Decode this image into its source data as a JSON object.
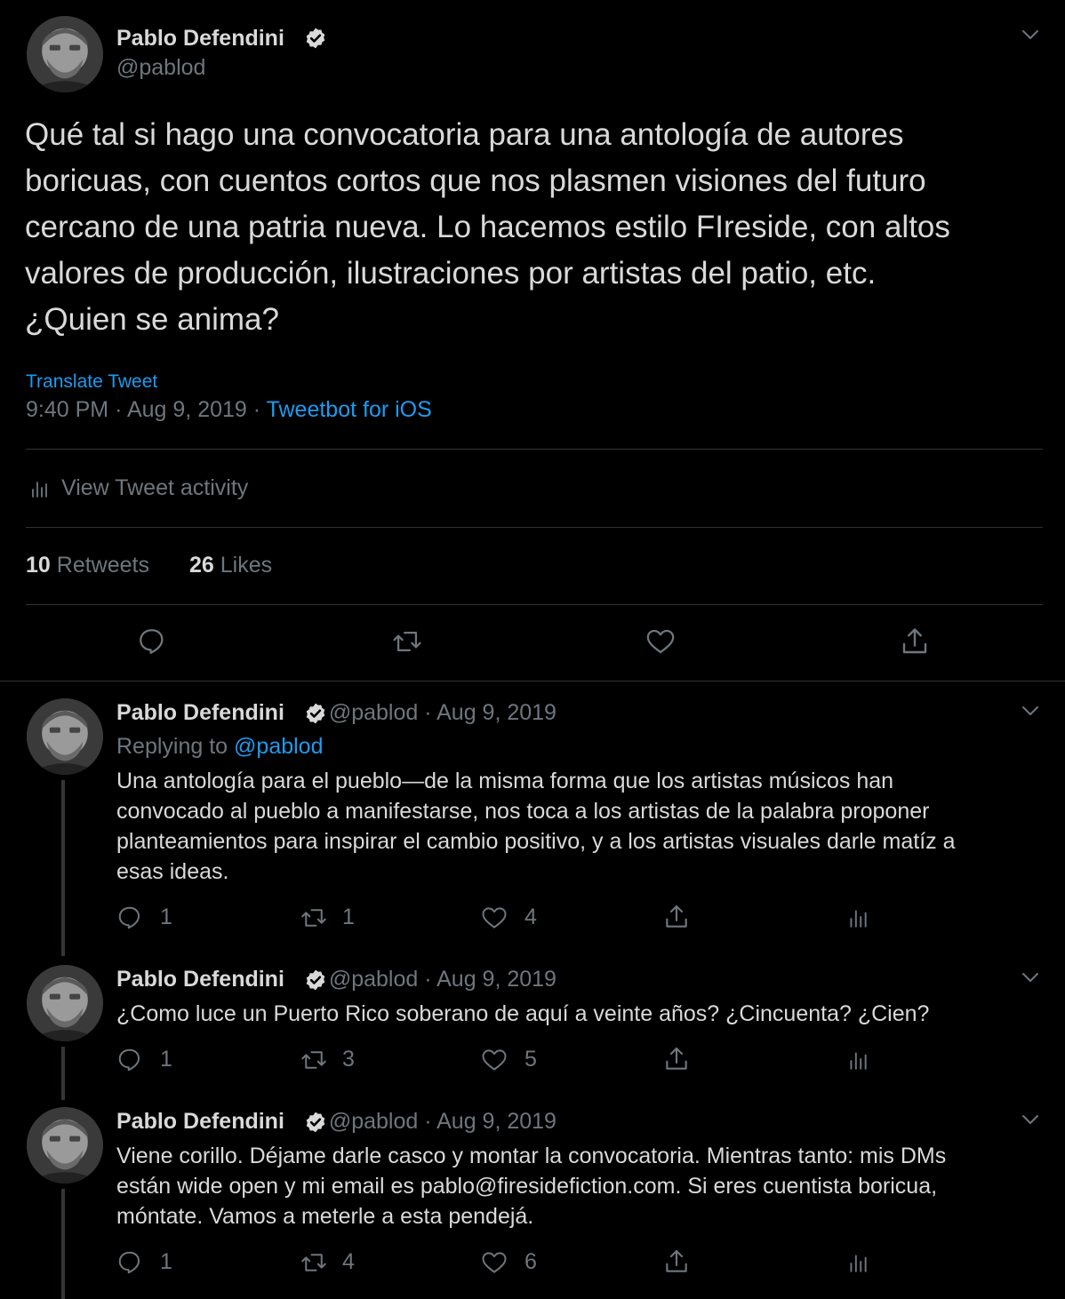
{
  "main_tweet": {
    "author_name": "Pablo Defendini",
    "handle": "@pablod",
    "text_lines": [
      "Qué tal si hago una convocatoria para una antología de autores",
      "boricuas, con cuentos cortos que nos plasmen visiones del futuro",
      "cercano de una patria nueva. Lo hacemos estilo FIreside, con altos",
      "valores de producción, ilustraciones por artistas del patio, etc.",
      "¿Quien se anima?"
    ],
    "translate_label": "Translate Tweet",
    "time": "9:40 PM",
    "sep": "·",
    "date": "Aug 9, 2019",
    "client": "Tweetbot for iOS",
    "activity_label": "View Tweet activity",
    "retweets_count": "10",
    "retweets_label": "Retweets",
    "likes_count": "26",
    "likes_label": "Likes"
  },
  "replies": [
    {
      "author_name": "Pablo Defendini",
      "handle": "@pablod",
      "sep": "·",
      "date": "Aug 9, 2019",
      "replying_to_label": "Replying to",
      "replying_to_handle": "@pablod",
      "text_lines": [
        "Una antología para el pueblo—de la misma forma que los artistas músicos han",
        "convocado al pueblo a manifestarse, nos toca a los artistas de la palabra proponer",
        "planteamientos para inspirar el cambio positivo, y a los artistas visuales darle matíz a",
        "esas ideas."
      ],
      "reply_count": "1",
      "retweet_count": "1",
      "like_count": "4"
    },
    {
      "author_name": "Pablo Defendini",
      "handle": "@pablod",
      "sep": "·",
      "date": "Aug 9, 2019",
      "text_lines": [
        "¿Como luce un Puerto Rico soberano de aquí a veinte años? ¿Cincuenta? ¿Cien?"
      ],
      "reply_count": "1",
      "retweet_count": "3",
      "like_count": "5"
    },
    {
      "author_name": "Pablo Defendini",
      "handle": "@pablod",
      "sep": "·",
      "date": "Aug 9, 2019",
      "text_lines": [
        "Viene corillo. Déjame darle casco y montar la convocatoria. Mientras tanto: mis DMs",
        "están wide open y mi email es pablo@firesidefiction.com. Si eres cuentista boricua,",
        "móntate. Vamos a meterle a esta pendejá."
      ],
      "reply_count": "1",
      "retweet_count": "4",
      "like_count": "6"
    }
  ],
  "icons": {
    "verified": "verified-badge-icon",
    "more": "chevron-down-icon",
    "reply": "reply-icon",
    "retweet": "retweet-icon",
    "like": "heart-icon",
    "share": "share-icon",
    "analytics": "analytics-icon"
  },
  "colors": {
    "background": "#000000",
    "text": "#d9d9d9",
    "secondary": "#6e767d",
    "accent": "#1d9bf0",
    "divider": "#2f3336"
  }
}
